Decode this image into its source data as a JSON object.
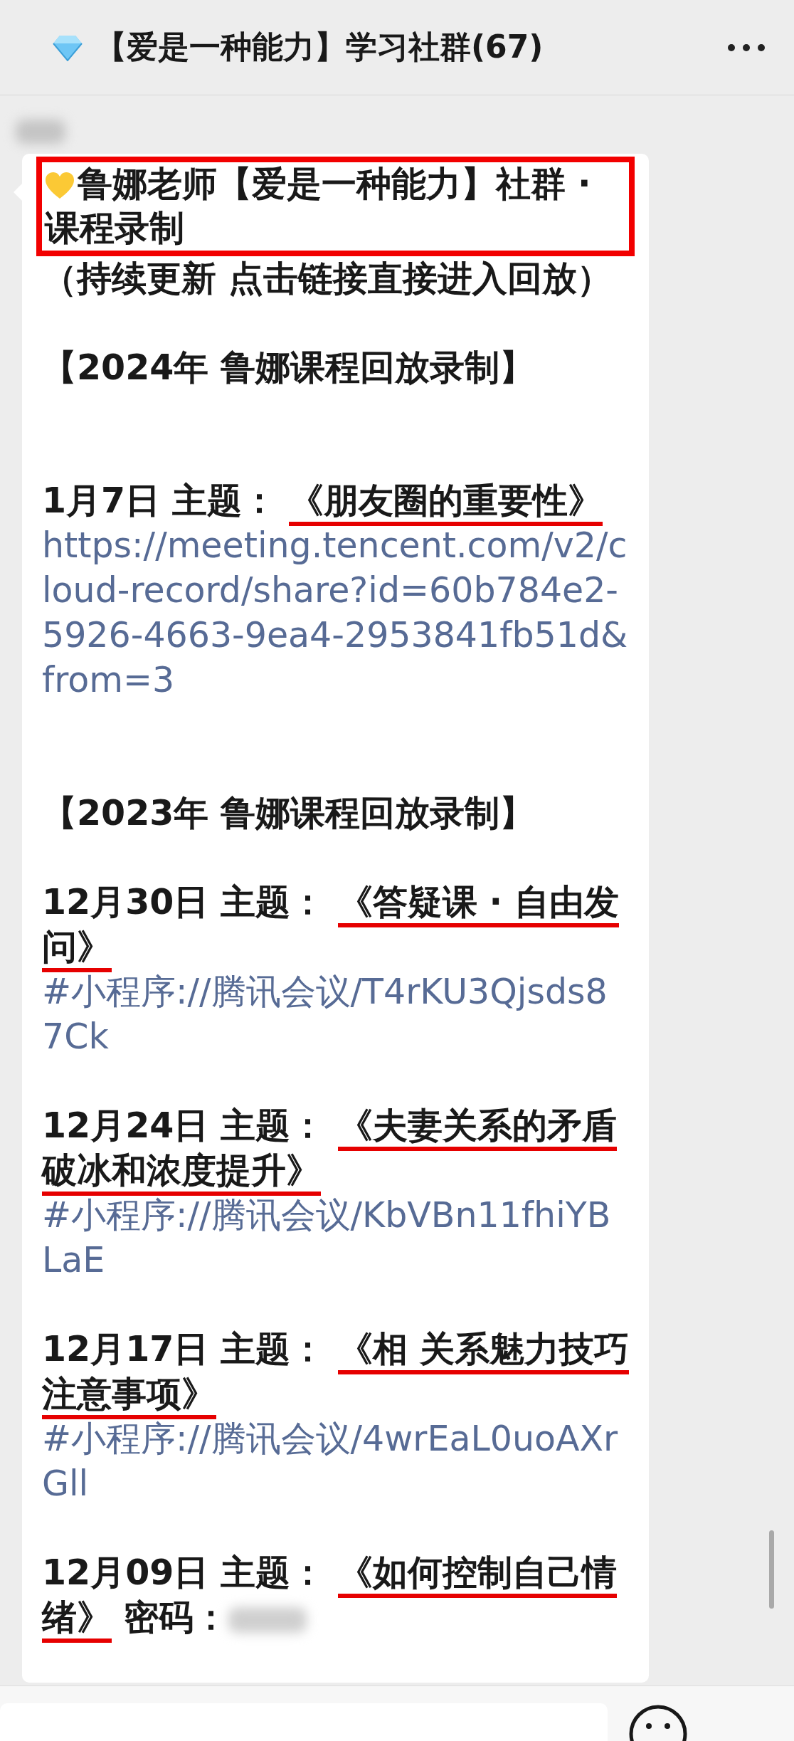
{
  "header": {
    "title": "【爱是一种能力】学习社群(67)"
  },
  "message": {
    "title": "鲁娜老师【爱是一种能力】社群 · 课程录制",
    "title_highlighted": true,
    "note": "（持续更新 点击链接直接进入回放）",
    "sections": [
      {
        "heading": "【2024年 鲁娜课程回放录制】",
        "entries": [
          {
            "date": "1月7日",
            "label": "主题：",
            "topic": "《朋友圈的重要性》",
            "underlined": true,
            "link": "https://meeting.tencent.com/v2/cloud-record/share?id=60b784e2-5926-4663-9ea4-2953841fb51d&from=3"
          }
        ]
      },
      {
        "heading": "【2023年 鲁娜课程回放录制】",
        "entries": [
          {
            "date": "12月30日",
            "label": "主题：",
            "topic": "《答疑课 · 自由发问》",
            "underlined": true,
            "link": "#小程序://腾讯会议/T4rKU3Qjsds87Ck"
          },
          {
            "date": "12月24日",
            "label": "主题：",
            "topic": "《夫妻关系的矛盾破冰和浓度提升》",
            "underlined": true,
            "link": "#小程序://腾讯会议/KbVBn11fhiYBLaE"
          },
          {
            "date": "12月17日",
            "label": "主题：",
            "topic": "《相 关系魅力技巧注意事项》",
            "underlined": true,
            "link": "#小程序://腾讯会议/4wrEaL0uoAXrGll"
          },
          {
            "date": "12月09日",
            "label": "主题：",
            "topic": "《如何控制自己情绪》",
            "underlined": true,
            "suffix": "密码："
          }
        ]
      }
    ]
  }
}
